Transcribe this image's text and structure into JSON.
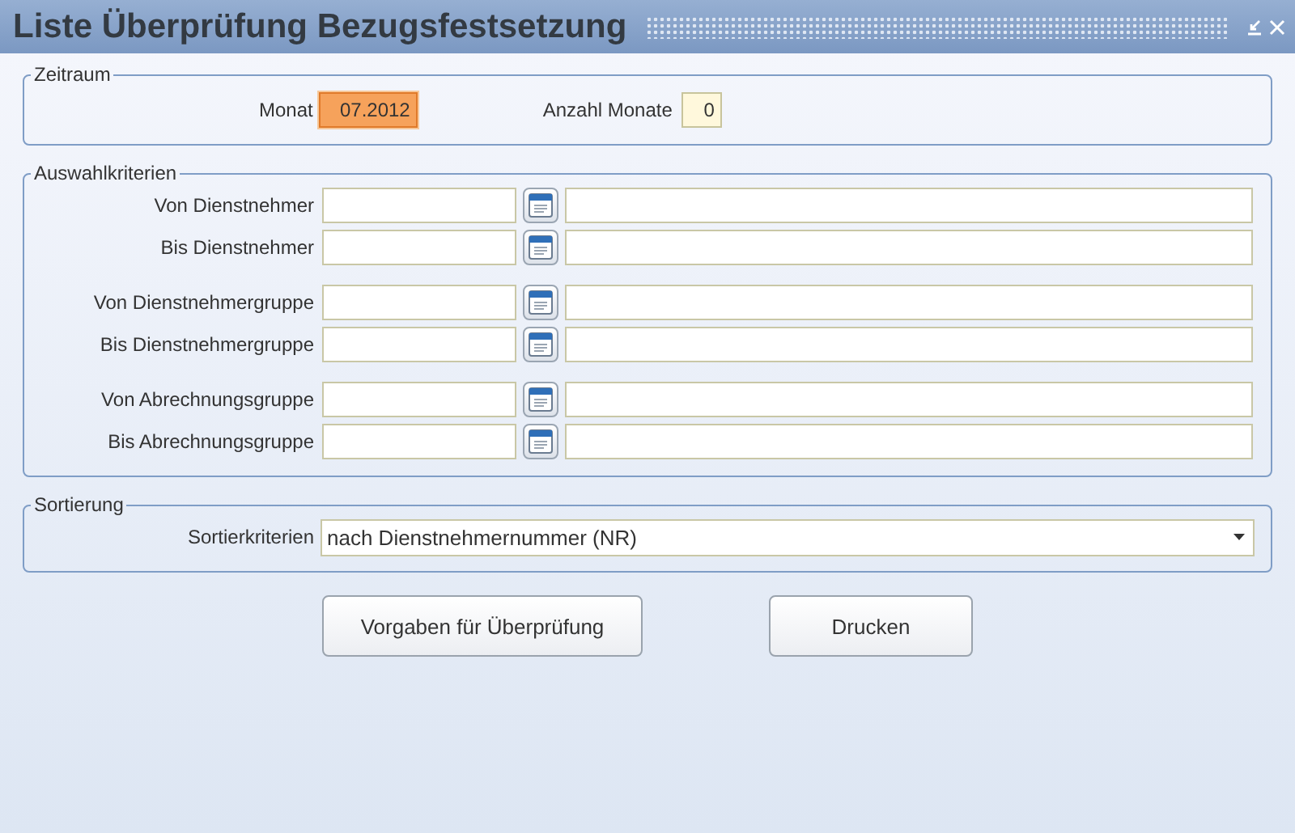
{
  "window": {
    "title": "Liste Überprüfung Bezugsfestsetzung"
  },
  "zeitraum": {
    "legend": "Zeitraum",
    "fields": [
      {
        "label": "Monat",
        "value": "07.2012",
        "focused": true
      },
      {
        "label": "Anzahl Monate",
        "value": "0",
        "focused": false
      }
    ]
  },
  "auswahlkriterien": {
    "legend": "Auswahlkriterien",
    "groups": [
      [
        {
          "label": "Von Dienstnehmer"
        },
        {
          "label": "Bis Dienstnehmer"
        }
      ],
      [
        {
          "label": "Von Dienstnehmergruppe"
        },
        {
          "label": "Bis Dienstnehmergruppe"
        }
      ],
      [
        {
          "label": "Von Abrechnungsgruppe"
        },
        {
          "label": "Bis Abrechnungsgruppe"
        }
      ]
    ]
  },
  "sortierung": {
    "legend": "Sortierung",
    "label": "Sortierkriterien",
    "value": "nach Dienstnehmernummer (NR)"
  },
  "buttons": [
    "Vorgaben für Überprüfung",
    "Drucken"
  ]
}
